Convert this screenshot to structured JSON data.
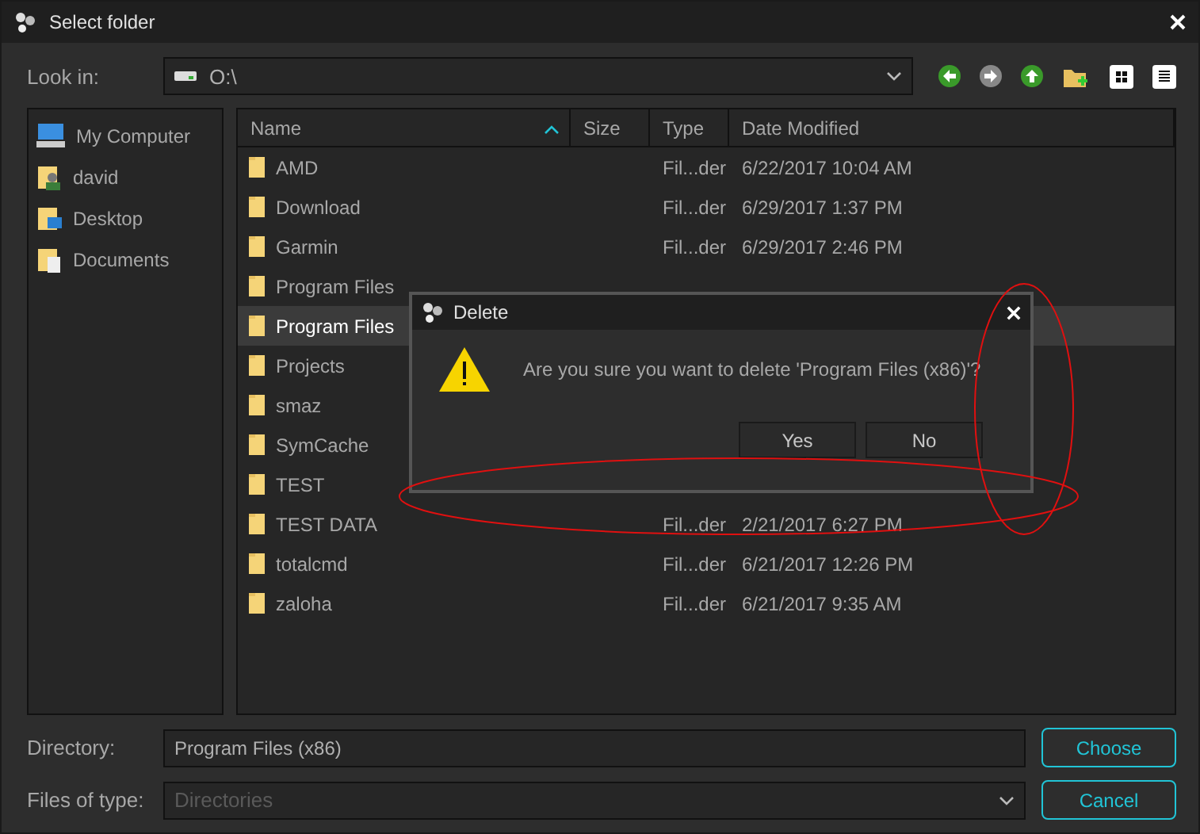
{
  "window": {
    "title": "Select folder"
  },
  "look_in": {
    "label": "Look in:",
    "value": "O:\\"
  },
  "sidebar": {
    "items": [
      {
        "label": "My Computer",
        "kind": "computer"
      },
      {
        "label": "david",
        "kind": "user"
      },
      {
        "label": "Desktop",
        "kind": "desktop"
      },
      {
        "label": "Documents",
        "kind": "documents"
      }
    ]
  },
  "table": {
    "columns": [
      {
        "label": "Name",
        "sorted": true
      },
      {
        "label": "Size",
        "sorted": false
      },
      {
        "label": "Type",
        "sorted": false
      },
      {
        "label": "Date Modified",
        "sorted": false
      }
    ],
    "rows": [
      {
        "name": "AMD",
        "type": "Fil...der",
        "date": "6/22/2017 10:04 AM",
        "selected": false
      },
      {
        "name": "Download",
        "type": "Fil...der",
        "date": "6/29/2017 1:37 PM",
        "selected": false
      },
      {
        "name": "Garmin",
        "type": "Fil...der",
        "date": "6/29/2017 2:46 PM",
        "selected": false
      },
      {
        "name": "Program Files",
        "selected": false
      },
      {
        "name": "Program Files",
        "selected": true
      },
      {
        "name": "Projects",
        "selected": false
      },
      {
        "name": "smaz",
        "selected": false
      },
      {
        "name": "SymCache",
        "selected": false
      },
      {
        "name": "TEST",
        "selected": false
      },
      {
        "name": "TEST DATA",
        "type": "Fil...der",
        "date": "2/21/2017 6:27 PM",
        "selected": false
      },
      {
        "name": "totalcmd",
        "type": "Fil...der",
        "date": "6/21/2017 12:26 PM",
        "selected": false
      },
      {
        "name": "zaloha",
        "type": "Fil...der",
        "date": "6/21/2017 9:35 AM",
        "selected": false
      }
    ]
  },
  "directory": {
    "label": "Directory:",
    "value": "Program Files (x86)"
  },
  "file_type": {
    "label": "Files of type:",
    "placeholder": "Directories"
  },
  "buttons": [
    "Choose",
    "Cancel"
  ],
  "dialog": {
    "title": "Delete",
    "message": "Are you sure you want to delete 'Program Files (x86)'?",
    "buttons": [
      "Yes",
      "No"
    ]
  }
}
